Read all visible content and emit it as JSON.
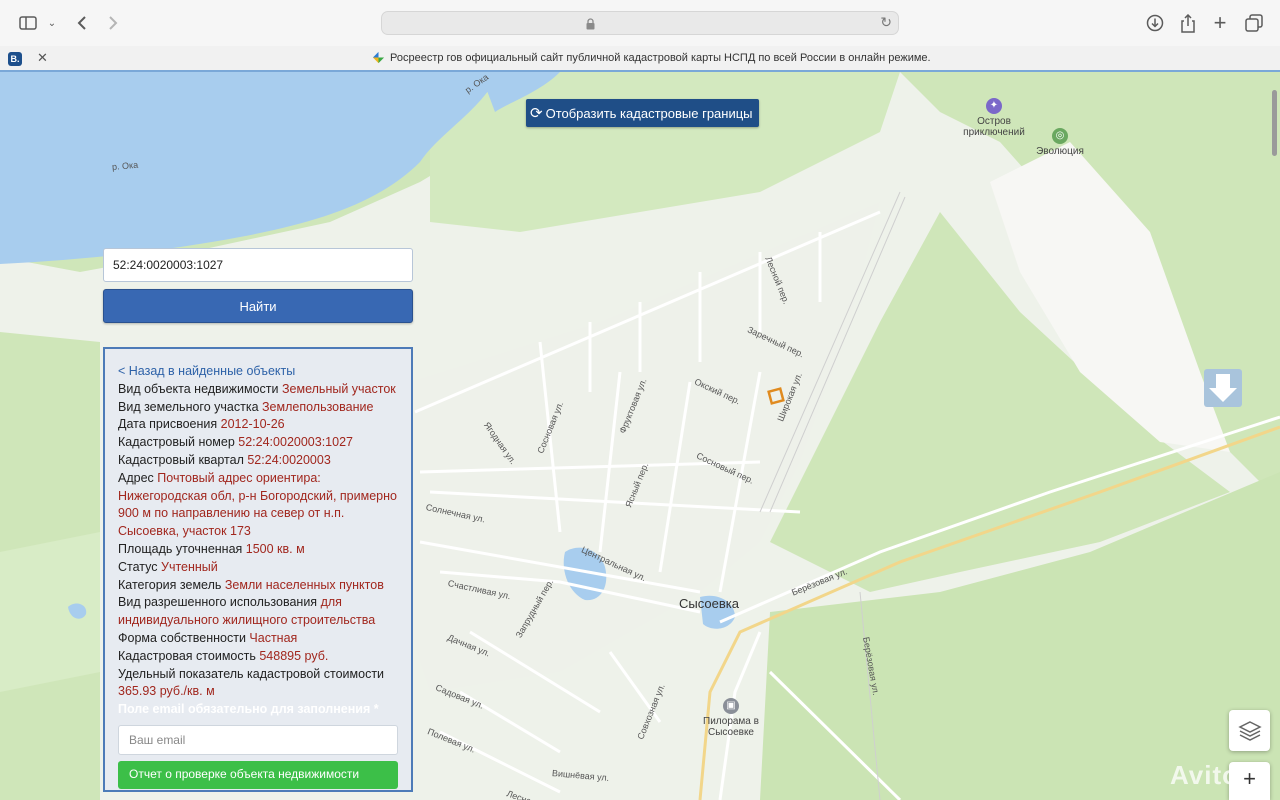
{
  "browser": {
    "tab_title": "Росреестр гов официальный сайт публичной кадастровой карты НСПД по всей России в онлайн режиме.",
    "tab_favicon_text": "B."
  },
  "map": {
    "show_borders_label": "Отобразить кадастровые границы",
    "search_value": "52:24:0020003:1027",
    "find_label": "Найти",
    "place_name": "Сысоевка",
    "river_label": "р. Ока",
    "pois": {
      "ostrov": "Остров приключений",
      "evolution": "Эволюция",
      "pilorama": "Пилорама в Сысоевке"
    },
    "streets": {
      "lesnoy": "Лесной пер.",
      "zarechny": "Заречный пер.",
      "oksky": "Окский пер.",
      "shirokaya": "Широкая ул.",
      "fruktovaya": "Фруктовая ул.",
      "sosnovaya": "Сосновая ул.",
      "yagodnaya": "Ягодная ул.",
      "sosnovy": "Сосновый пер.",
      "yasny": "Ясный пер.",
      "solnechnaya": "Солнечная ул.",
      "tsentralnaya": "Центральная ул.",
      "schastlivaya": "Счастливая ул.",
      "zaprudny": "Запрудный пер.",
      "dachnaya": "Дачная ул.",
      "sadovaya": "Садовая ул.",
      "polevaya": "Полевая ул.",
      "vishnevaya": "Вишнёвая ул.",
      "lesnaya": "Лесная ул.",
      "sovkhoznaya": "Совхозная ул.",
      "berezovaya": "Берёзовая ул.",
      "berezovaya2": "Берёзовая ул."
    },
    "watermark": "Avito"
  },
  "info": {
    "back_link": "< Назад в найденные объекты",
    "rows": [
      {
        "label": "Вид объекта недвижимости",
        "value": "Земельный участок"
      },
      {
        "label": "Вид земельного участка",
        "value": "Землепользование"
      },
      {
        "label": "Дата присвоения",
        "value": "2012-10-26"
      },
      {
        "label": "Кадастровый номер",
        "value": "52:24:0020003:1027"
      },
      {
        "label": "Кадастровый квартал",
        "value": "52:24:0020003"
      },
      {
        "label": "Адрес",
        "value": "Почтовый адрес ориентира: Нижегородская обл, р-н Богородский, примерно 900 м по направлению на север от н.п. Сысоевка, участок 173"
      },
      {
        "label": "Площадь уточненная",
        "value": "1500 кв. м"
      },
      {
        "label": "Статус",
        "value": "Учтенный"
      },
      {
        "label": "Категория земель",
        "value": "Земли населенных пунктов"
      },
      {
        "label": "Вид разрешенного использования",
        "value": "для индивидуального жилищного строительства"
      },
      {
        "label": "Форма собственности",
        "value": "Частная"
      },
      {
        "label": "Кадастровая стоимость",
        "value": "548895 руб."
      },
      {
        "label": "Удельный показатель кадастровой стоимости",
        "value": "365.93 руб./кв. м"
      }
    ],
    "email_label": "Поле email обязательно для заполнения *",
    "email_placeholder": "Ваш email",
    "report_button": "Отчет о проверке объекта недвижимости"
  },
  "colors": {
    "water": "#a8cdee",
    "forest": "#cbe4b4",
    "parcel_marker": "#e08a1e",
    "panel_border": "#4d7bb8",
    "value_text": "#a1271e"
  }
}
